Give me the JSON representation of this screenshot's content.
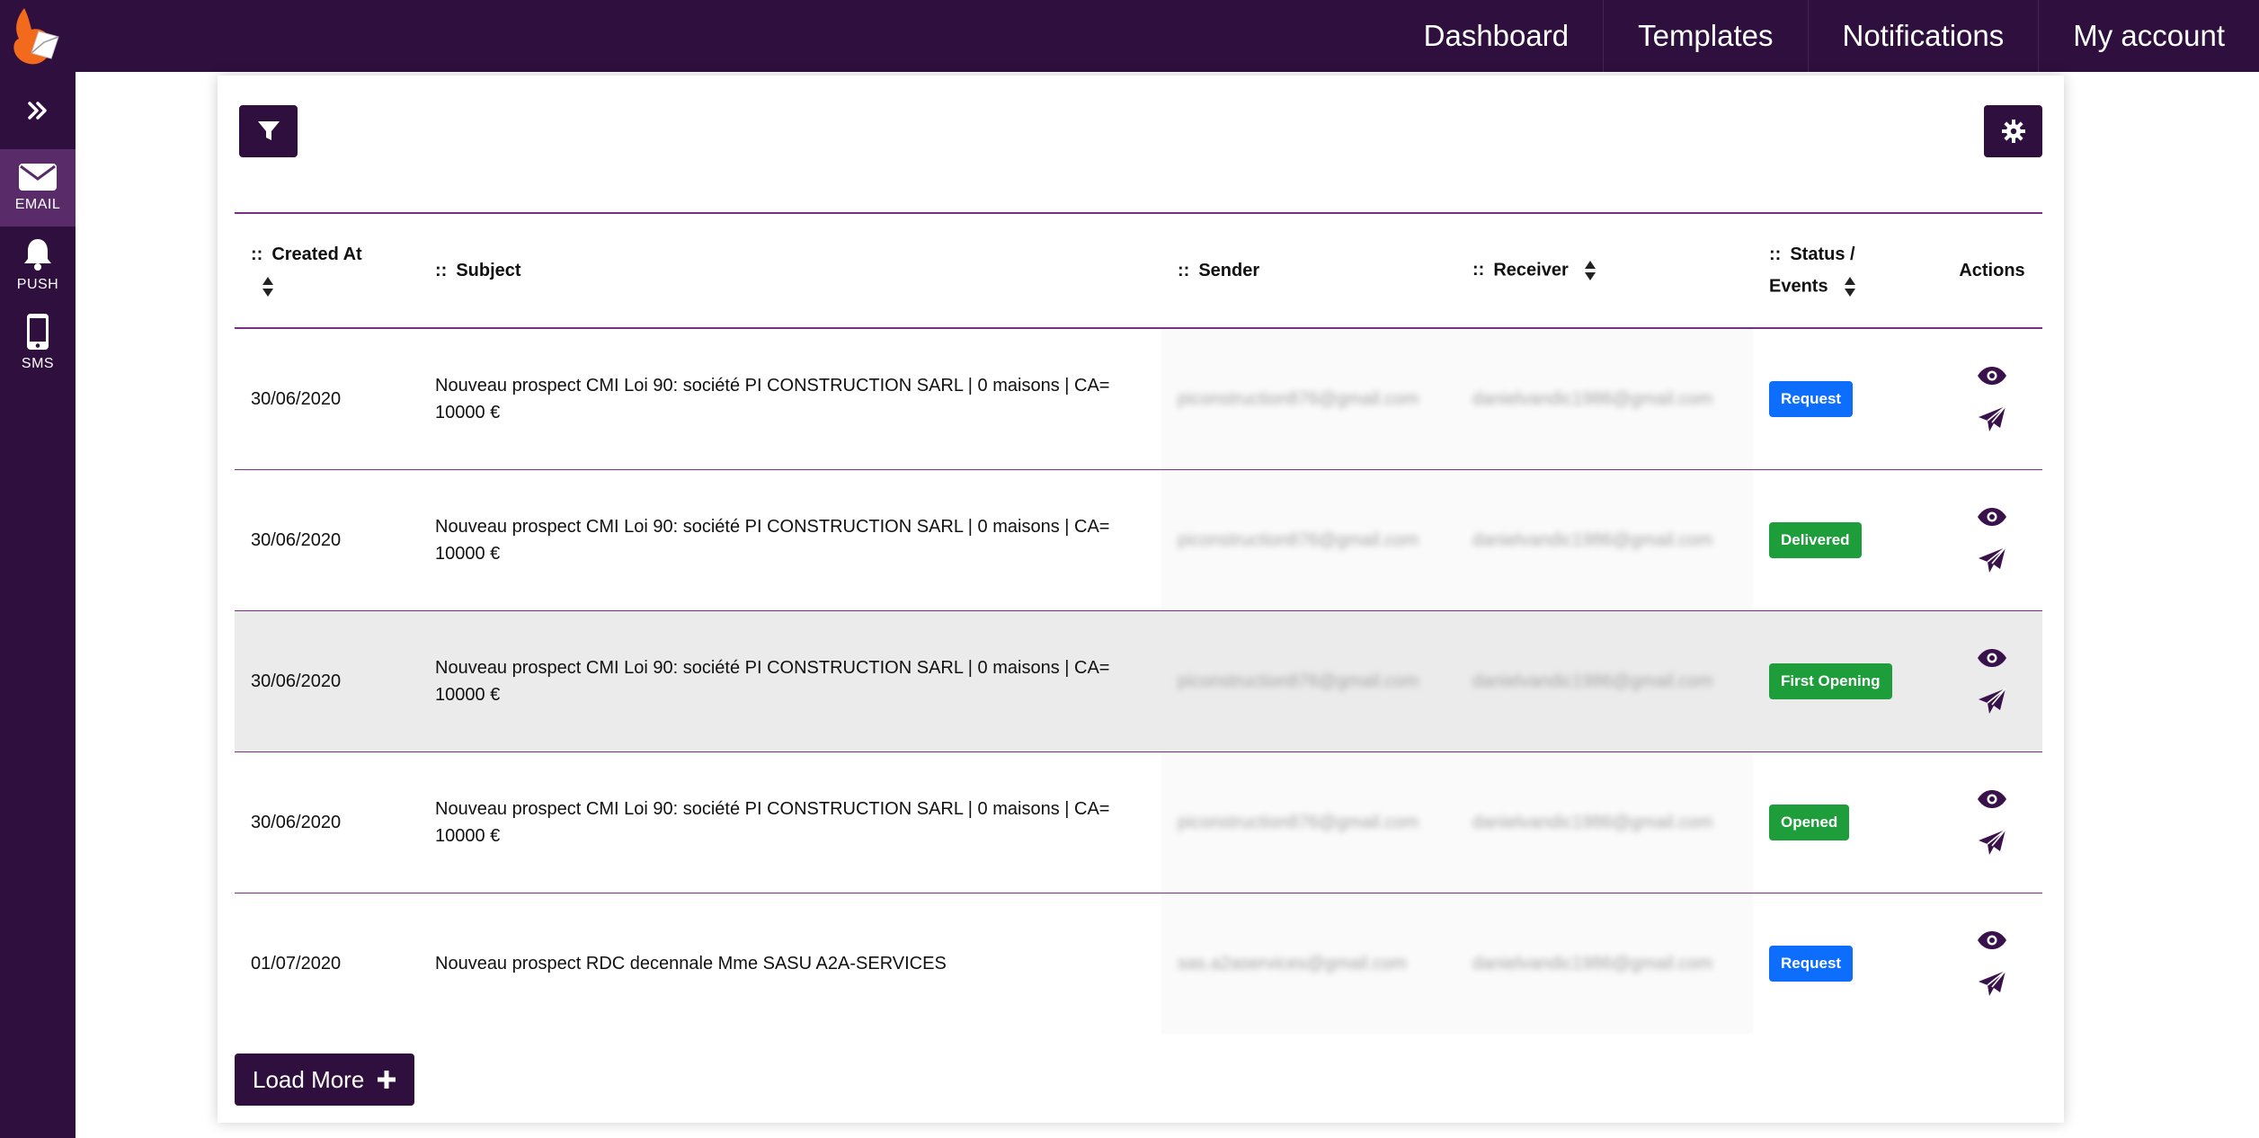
{
  "nav": {
    "items": [
      "Dashboard",
      "Templates",
      "Notifications",
      "My account"
    ]
  },
  "sidebar": {
    "items": [
      {
        "label": "EMAIL",
        "icon": "envelope-icon",
        "active": true
      },
      {
        "label": "PUSH",
        "icon": "bell-icon",
        "active": false
      },
      {
        "label": "SMS",
        "icon": "phone-icon",
        "active": false
      }
    ]
  },
  "table": {
    "headers": {
      "created_at": "Created At",
      "subject": "Subject",
      "sender": "Sender",
      "receiver": "Receiver",
      "status_line1": "Status /",
      "status_line2": "Events",
      "actions": "Actions"
    },
    "header_prefix": "::",
    "rows": [
      {
        "date": "30/06/2020",
        "subject_line1": "Nouveau prospect CMI Loi 90: société PI CONSTRUCTION SARL | 0 maisons | CA=",
        "subject_line2": "10000 €",
        "sender": "piconstruction876@gmail.com",
        "receiver": "danielvandic1986@gmail.com",
        "status": "Request"
      },
      {
        "date": "30/06/2020",
        "subject_line1": "Nouveau prospect CMI Loi 90: société PI CONSTRUCTION SARL | 0 maisons | CA=",
        "subject_line2": "10000 €",
        "sender": "piconstruction876@gmail.com",
        "receiver": "danielvandic1986@gmail.com",
        "status": "Delivered"
      },
      {
        "date": "30/06/2020",
        "subject_line1": "Nouveau prospect CMI Loi 90: société PI CONSTRUCTION SARL | 0 maisons | CA=",
        "subject_line2": "10000 €",
        "sender": "piconstruction876@gmail.com",
        "receiver": "danielvandic1986@gmail.com",
        "status": "First Opening"
      },
      {
        "date": "30/06/2020",
        "subject_line1": "Nouveau prospect CMI Loi 90: société PI CONSTRUCTION SARL | 0 maisons | CA=",
        "subject_line2": "10000 €",
        "sender": "piconstruction876@gmail.com",
        "receiver": "danielvandic1986@gmail.com",
        "status": "Opened"
      },
      {
        "date": "01/07/2020",
        "subject_line1": "Nouveau prospect RDC decennale Mme SASU A2A-SERVICES",
        "subject_line2": "",
        "sender": "sas.a2aservices@gmail.com",
        "receiver": "danielvandic1986@gmail.com",
        "status": "Request"
      }
    ]
  },
  "load_more": {
    "label": "Load More"
  },
  "colors": {
    "brand": "#2f0f3d",
    "badge_request": "#0d6efd",
    "badge_success": "#1e9e3b",
    "row_divider": "#7a2f86"
  }
}
